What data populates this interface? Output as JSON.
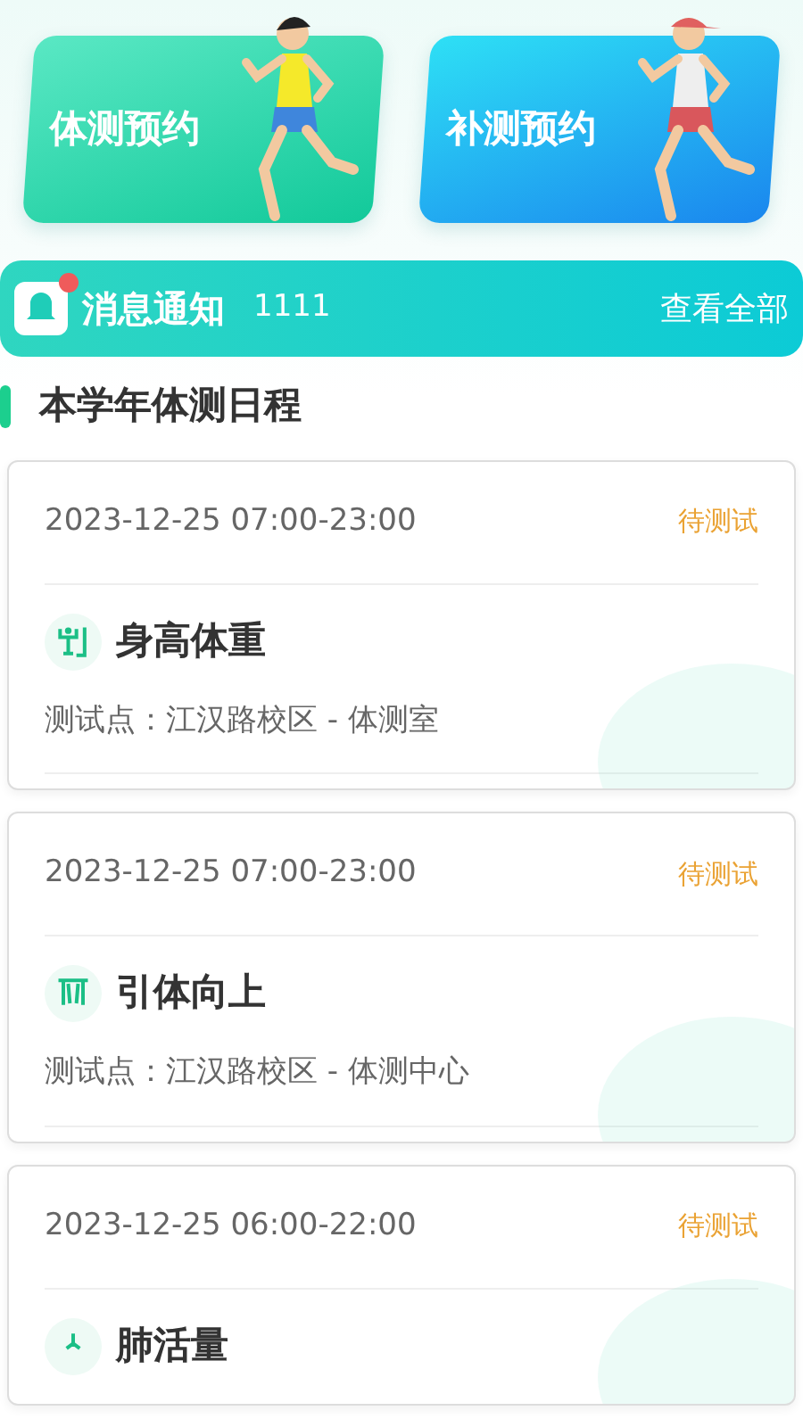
{
  "banners": [
    {
      "label": "体测预约",
      "kind": "green"
    },
    {
      "label": "补测预约",
      "kind": "blue"
    }
  ],
  "notice": {
    "title": "消息通知",
    "count": "1111",
    "unread": true,
    "link": "查看全部"
  },
  "section_title": "本学年体测日程",
  "schedule": [
    {
      "time": "2023-12-25 07:00-23:00",
      "status": "待测试",
      "name": "身高体重",
      "kind": "height-weight",
      "location": "测试点：江汉路校区 - 体测室"
    },
    {
      "time": "2023-12-25 07:00-23:00",
      "status": "待测试",
      "name": "引体向上",
      "kind": "pull-up",
      "location": "测试点：江汉路校区 - 体测中心"
    },
    {
      "time": "2023-12-25 06:00-22:00",
      "status": "待测试",
      "name": "肺活量",
      "kind": "lung"
    }
  ]
}
